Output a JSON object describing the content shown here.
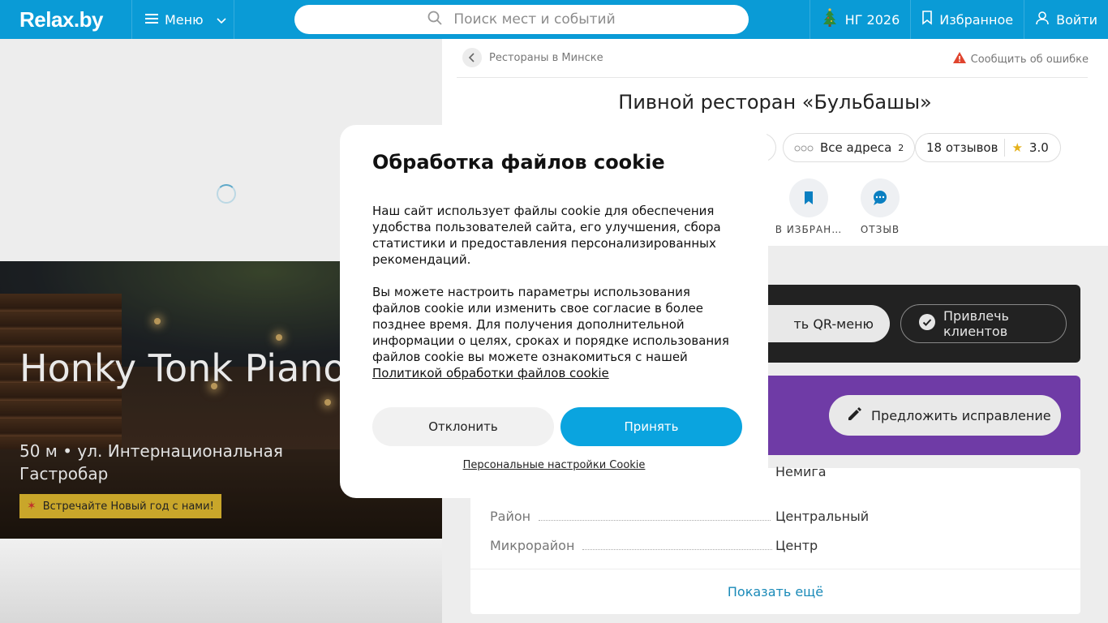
{
  "header": {
    "logo": "Relax.by",
    "menu_label": "Меню",
    "search_placeholder": "Поиск мест и событий",
    "ny_label": "НГ 2026",
    "favorites_label": "Избранное",
    "login_label": "Войти",
    "brand_color": "#0a9bd6"
  },
  "hero": {
    "title": "Honky Tonk Piano Bar",
    "subtitle_line1": "50 м • ул. Интернациональная",
    "subtitle_line2": "Гастробар",
    "promo": "Встречайте Новый год с нами!"
  },
  "place": {
    "breadcrumb": "Рестораны в Минске",
    "report_label": "Сообщить об ошибке",
    "title": "Пивной ресторан «Бульбашы»",
    "addresses_label": "Все адреса",
    "addresses_count": "2",
    "reviews_label": "18 отзывов",
    "rating": "3.0",
    "action_favorite": "В ИЗБРАН…",
    "action_review": "ОТЗЫВ",
    "qr_menu_label": "ть QR-меню",
    "attract_label": "Привлечь клиентов",
    "suggest_fix_label": "Предложить исправление"
  },
  "info_rows": [
    {
      "key": "",
      "value": "Немига"
    },
    {
      "key": "Район",
      "value": "Центральный"
    },
    {
      "key": "Микрорайон",
      "value": "Центр"
    }
  ],
  "show_more": "Показать ещё",
  "cookie": {
    "title": "Обработка файлов cookie",
    "paragraph1": "Наш сайт использует файлы cookie для обеспечения удобства пользователей сайта, его улучшения, сбора статистики и предоставления персонализированных рекомендаций.",
    "paragraph2": "Вы можете настроить параметры использования файлов cookie или изменить свое согласие в более позднее время. Для получения дополнительной информации о целях, сроках и порядке использования файлов cookie вы можете ознакомиться с нашей",
    "policy_link": "Политикой обработки файлов cookie",
    "decline": "Отклонить",
    "accept": "Принять",
    "personal_settings": "Персональные настройки Cookie",
    "accept_color": "#0aa4df"
  }
}
